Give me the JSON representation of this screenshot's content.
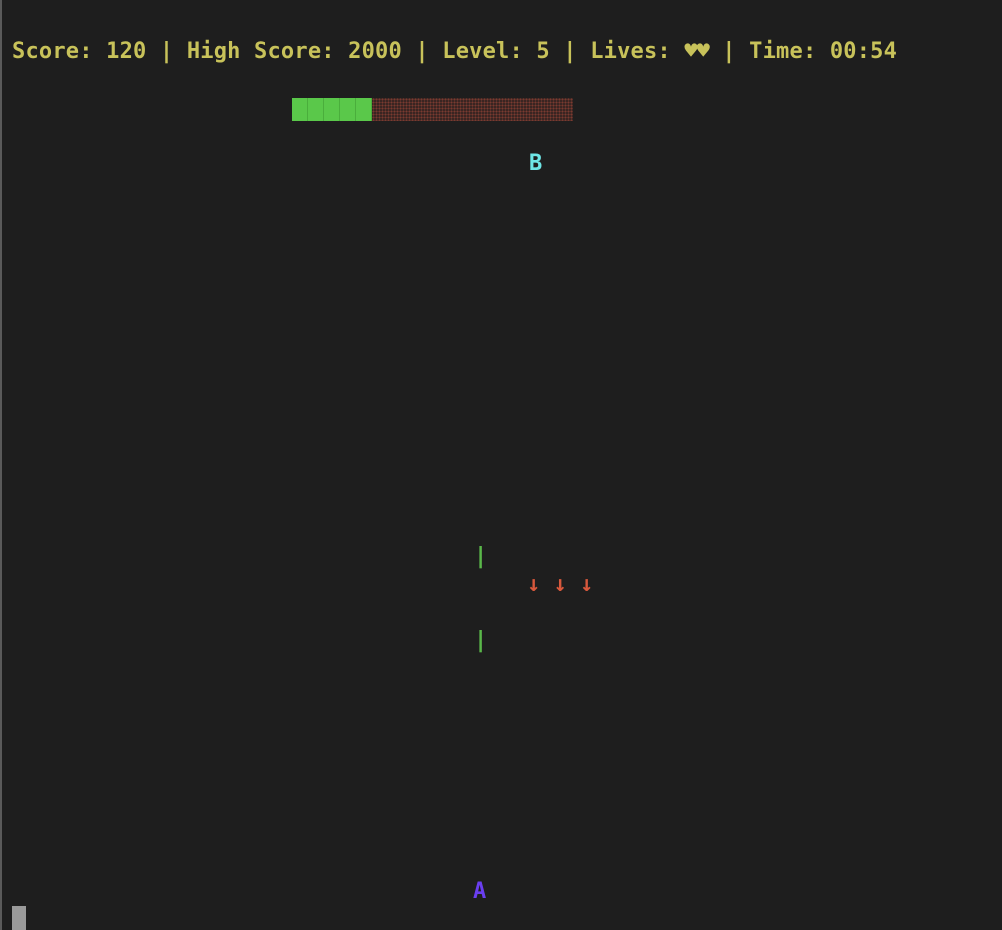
{
  "hud": {
    "score_label": "Score: ",
    "score": "120",
    "sep1": " | ",
    "high_score_label": "High Score: ",
    "high_score": "2000",
    "sep2": " | ",
    "level_label": "Level: ",
    "level": "5",
    "sep3": " | ",
    "lives_label": "Lives: ",
    "lives": "♥♥",
    "sep4": " | ",
    "time_label": "Time: ",
    "time": "00:54"
  },
  "health_bar": {
    "filled_cells": 5,
    "fraction": 0.3,
    "fill_color": "#5ac84a",
    "empty_color": "#3a2522"
  },
  "entities": {
    "boss": "B",
    "player": "A",
    "wall_top": "|",
    "wall_bottom": "|",
    "projectiles": "↓ ↓ ↓"
  },
  "colors": {
    "background": "#1e1e1e",
    "hud": "#c8c25a",
    "boss": "#6ee6e6",
    "player": "#6a3ef0",
    "wall": "#5ab84a",
    "projectile": "#d8583c"
  }
}
